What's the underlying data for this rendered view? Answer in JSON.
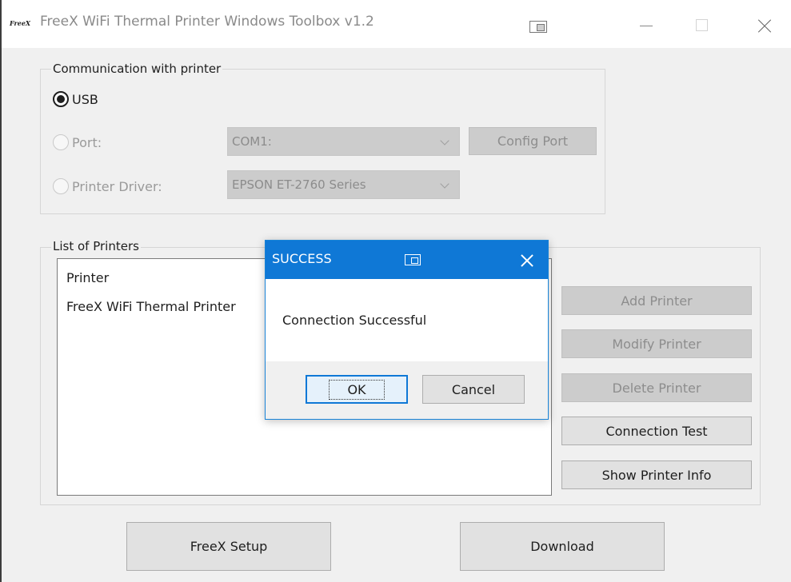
{
  "window": {
    "logo_text": "FreeX",
    "title": "FreeX WiFi Thermal Printer Windows Toolbox v1.2"
  },
  "communication": {
    "legend": "Communication with printer",
    "usb_label": "USB",
    "port_label": "Port:",
    "port_value": "COM1:",
    "config_port_label": "Config Port",
    "driver_label": "Printer Driver:",
    "driver_value": "EPSON ET-2760 Series",
    "selected": "USB"
  },
  "printers": {
    "legend": "List of Printers",
    "items": [
      "Printer",
      "FreeX WiFi Thermal Printer"
    ],
    "buttons": {
      "add": "Add Printer",
      "modify": "Modify Printer",
      "delete": "Delete Printer",
      "test": "Connection Test",
      "info": "Show Printer Info"
    }
  },
  "footer": {
    "setup_label": "FreeX Setup",
    "download_label": "Download"
  },
  "dialog": {
    "title": "SUCCESS",
    "message": "Connection Successful",
    "ok_label": "OK",
    "cancel_label": "Cancel"
  },
  "colors": {
    "dialog_titlebar": "#0f78d6",
    "window_bg": "#f0f0f0",
    "disabled_bg": "#cccccc"
  }
}
